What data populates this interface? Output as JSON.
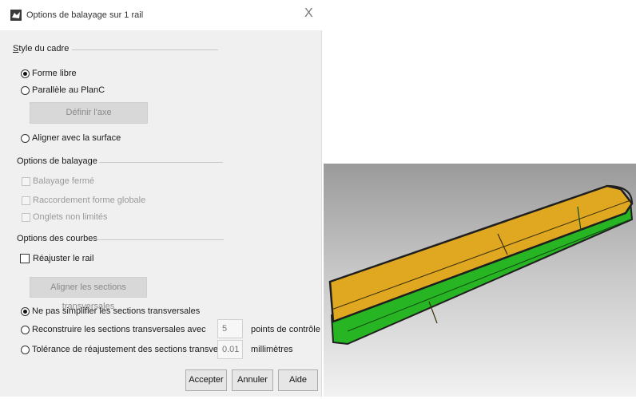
{
  "dialog": {
    "title": "Options de balayage sur 1 rail",
    "close_glyph": "X"
  },
  "frame_style": {
    "heading": "Style du cadre",
    "options": [
      {
        "label": "Forme libre",
        "selected": true
      },
      {
        "label": "Parallèle au PlanC",
        "selected": false
      },
      {
        "label": "Aligner avec la surface",
        "selected": false
      }
    ],
    "define_axis_button": "Définir l'axe"
  },
  "sweep_options": {
    "heading": "Options de balayage",
    "checkboxes": [
      {
        "label": "Balayage fermé",
        "checked": false,
        "enabled": false
      },
      {
        "label": "Raccordement forme globale",
        "checked": false,
        "enabled": false
      },
      {
        "label": "Onglets non limités",
        "checked": false,
        "enabled": false
      }
    ]
  },
  "curve_options": {
    "heading": "Options des courbes",
    "refit_rail": {
      "label": "Réajuster le rail",
      "checked": false
    },
    "align_sections_button": "Aligner les sections transversales",
    "radios": [
      {
        "label": "Ne pas simplifier les sections transversales",
        "selected": true
      },
      {
        "label": "Reconstruire les sections transversales avec",
        "selected": false,
        "value": "5",
        "unit": "points de contrôle"
      },
      {
        "label": "Tolérance de réajustement des sections transversales",
        "selected": false,
        "value": "0.01",
        "unit": "millimètres"
      }
    ]
  },
  "buttons": {
    "accept": "Accepter",
    "cancel": "Annuler",
    "help": "Aide"
  },
  "preview": {
    "colors": {
      "top": "#e0a821",
      "bottom": "#27b523",
      "edge": "#1f1f1f"
    }
  }
}
